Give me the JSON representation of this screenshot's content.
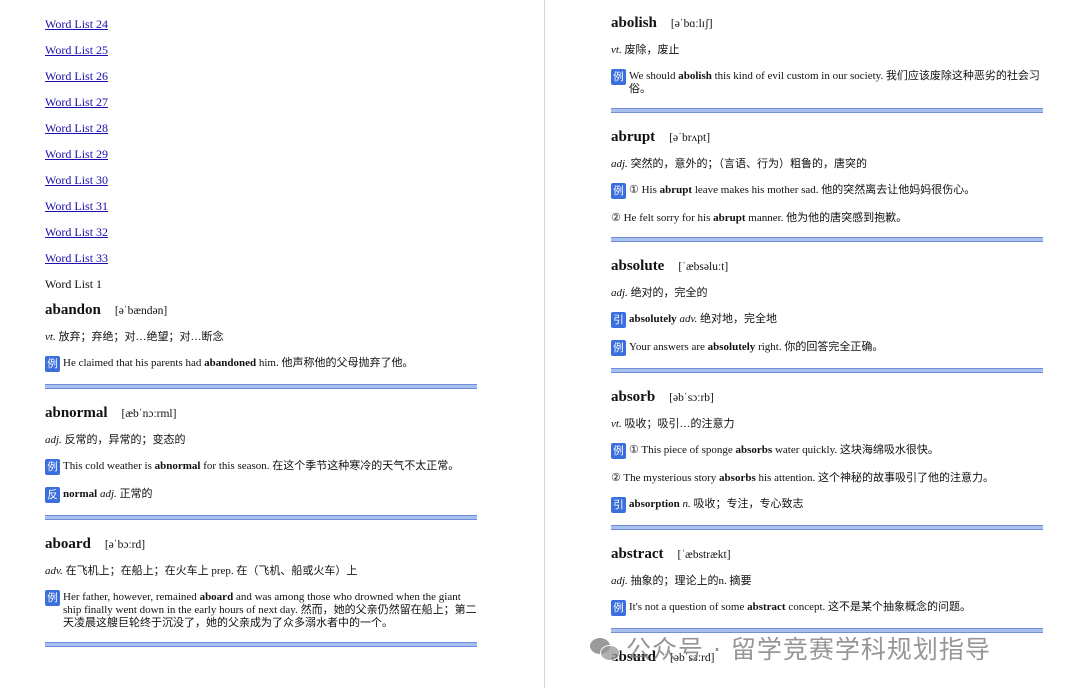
{
  "toc": {
    "links": [
      "Word List 24",
      "Word List 25",
      "Word List 26",
      "Word List 27",
      "Word List 28",
      "Word List 29",
      "Word List 30",
      "Word List 31",
      "Word List 32",
      "Word List 33"
    ],
    "current": "Word List 1"
  },
  "entries": [
    {
      "word": "abandon",
      "ipa": "[əˈbændən]",
      "pos": "vt.",
      "def": "放弃；弃绝；对…绝望；对…断念",
      "examples": [
        {
          "badge": "例",
          "parts": [
            [
              "He claimed that his parents had ",
              ""
            ],
            [
              "abandoned",
              "b"
            ],
            [
              " him. 他声称他的父母抛弃了他。",
              ""
            ]
          ]
        }
      ]
    },
    {
      "word": "abnormal",
      "ipa": "[æbˈnɔːrml]",
      "pos": "adj.",
      "def": "反常的，异常的；变态的",
      "examples": [
        {
          "badge": "例",
          "parts": [
            [
              "This cold weather is ",
              ""
            ],
            [
              "abnormal",
              "b"
            ],
            [
              " for this season. 在这个季节这种寒冷的天气不太正常。",
              ""
            ]
          ]
        },
        {
          "badge": "反",
          "parts": [
            [
              "normal",
              "b"
            ],
            [
              " ",
              ""
            ],
            [
              "adj.",
              "i"
            ],
            [
              " 正常的",
              ""
            ]
          ]
        }
      ]
    },
    {
      "word": "aboard",
      "ipa": "[əˈbɔːrd]",
      "pos": "adv.",
      "def": "在飞机上；在船上；在火车上 prep. 在（飞机、船或火车）上",
      "examples": [
        {
          "badge": "例",
          "parts": [
            [
              "Her father, however, remained ",
              ""
            ],
            [
              "aboard",
              "b"
            ],
            [
              " and was among those who drowned when the giant ship finally went down in the early hours of next day. 然而，她的父亲仍然留在船上；第二天凌晨这艘巨轮终于沉没了，她的父亲成为了众多溺水者中的一个。",
              ""
            ]
          ]
        }
      ]
    },
    {
      "word": "abolish",
      "ipa": "[əˈbɑːlɪʃ]",
      "pos": "vt.",
      "def": "废除，废止",
      "examples": [
        {
          "badge": "例",
          "parts": [
            [
              "We should ",
              ""
            ],
            [
              "abolish",
              "b"
            ],
            [
              " this kind of evil custom in our society. 我们应该废除这种恶劣的社会习俗。",
              ""
            ]
          ]
        }
      ]
    },
    {
      "word": "abrupt",
      "ipa": "[əˈbrʌpt]",
      "pos": "adj.",
      "def": "突然的，意外的；（言语、行为）粗鲁的，唐突的",
      "examples": [
        {
          "badge": "例",
          "parts": [
            [
              "① His ",
              ""
            ],
            [
              "abrupt",
              "b"
            ],
            [
              " leave makes his mother sad. 他的突然离去让他妈妈很伤心。",
              ""
            ]
          ]
        },
        {
          "badge": "",
          "parts": [
            [
              "② He felt sorry for his ",
              ""
            ],
            [
              "abrupt",
              "b"
            ],
            [
              " manner. 他为他的唐突感到抱歉。",
              ""
            ]
          ]
        }
      ]
    },
    {
      "word": "absolute",
      "ipa": "[ˈæbsəluːt]",
      "pos": "adj.",
      "def": "绝对的，完全的",
      "examples": [
        {
          "badge": "引",
          "parts": [
            [
              "absolutely",
              "b"
            ],
            [
              " ",
              ""
            ],
            [
              "adv.",
              "i"
            ],
            [
              " 绝对地，完全地",
              ""
            ]
          ]
        },
        {
          "badge": "例",
          "parts": [
            [
              "Your answers are ",
              ""
            ],
            [
              "absolutely",
              "b"
            ],
            [
              " right. 你的回答完全正确。",
              ""
            ]
          ]
        }
      ]
    },
    {
      "word": "absorb",
      "ipa": "[əbˈsɔːrb]",
      "pos": "vt.",
      "def": "吸收；吸引…的注意力",
      "examples": [
        {
          "badge": "例",
          "parts": [
            [
              "① This piece of sponge ",
              ""
            ],
            [
              "absorbs",
              "b"
            ],
            [
              " water quickly. 这块海绵吸水很快。",
              ""
            ]
          ]
        },
        {
          "badge": "",
          "parts": [
            [
              "② The mysterious story ",
              ""
            ],
            [
              "absorbs",
              "b"
            ],
            [
              " his attention. 这个神秘的故事吸引了他的注意力。",
              ""
            ]
          ]
        },
        {
          "badge": "引",
          "parts": [
            [
              "absorption",
              "b"
            ],
            [
              " ",
              ""
            ],
            [
              "n.",
              "i"
            ],
            [
              " 吸收；专注，专心致志",
              ""
            ]
          ]
        }
      ]
    },
    {
      "word": "abstract",
      "ipa": "[ˈæbstrækt]",
      "pos": "adj.",
      "def": "抽象的；理论上的n. 摘要",
      "examples": [
        {
          "badge": "例",
          "parts": [
            [
              "It's not a question of some ",
              ""
            ],
            [
              "abstract",
              "b"
            ],
            [
              " concept. 这不是某个抽象概念的问题。",
              ""
            ]
          ]
        }
      ]
    },
    {
      "word": "absurd",
      "ipa": "[əbˈsɜːrd]",
      "pos": "",
      "def": "",
      "examples": []
    }
  ],
  "watermark": {
    "icon": "wechat-icon",
    "text": "公众号 · 留学竞赛学科规划指导"
  },
  "colors": {
    "badge": "#3b6fdc",
    "link": "#1a0dab",
    "separator": "#a9bff0"
  }
}
